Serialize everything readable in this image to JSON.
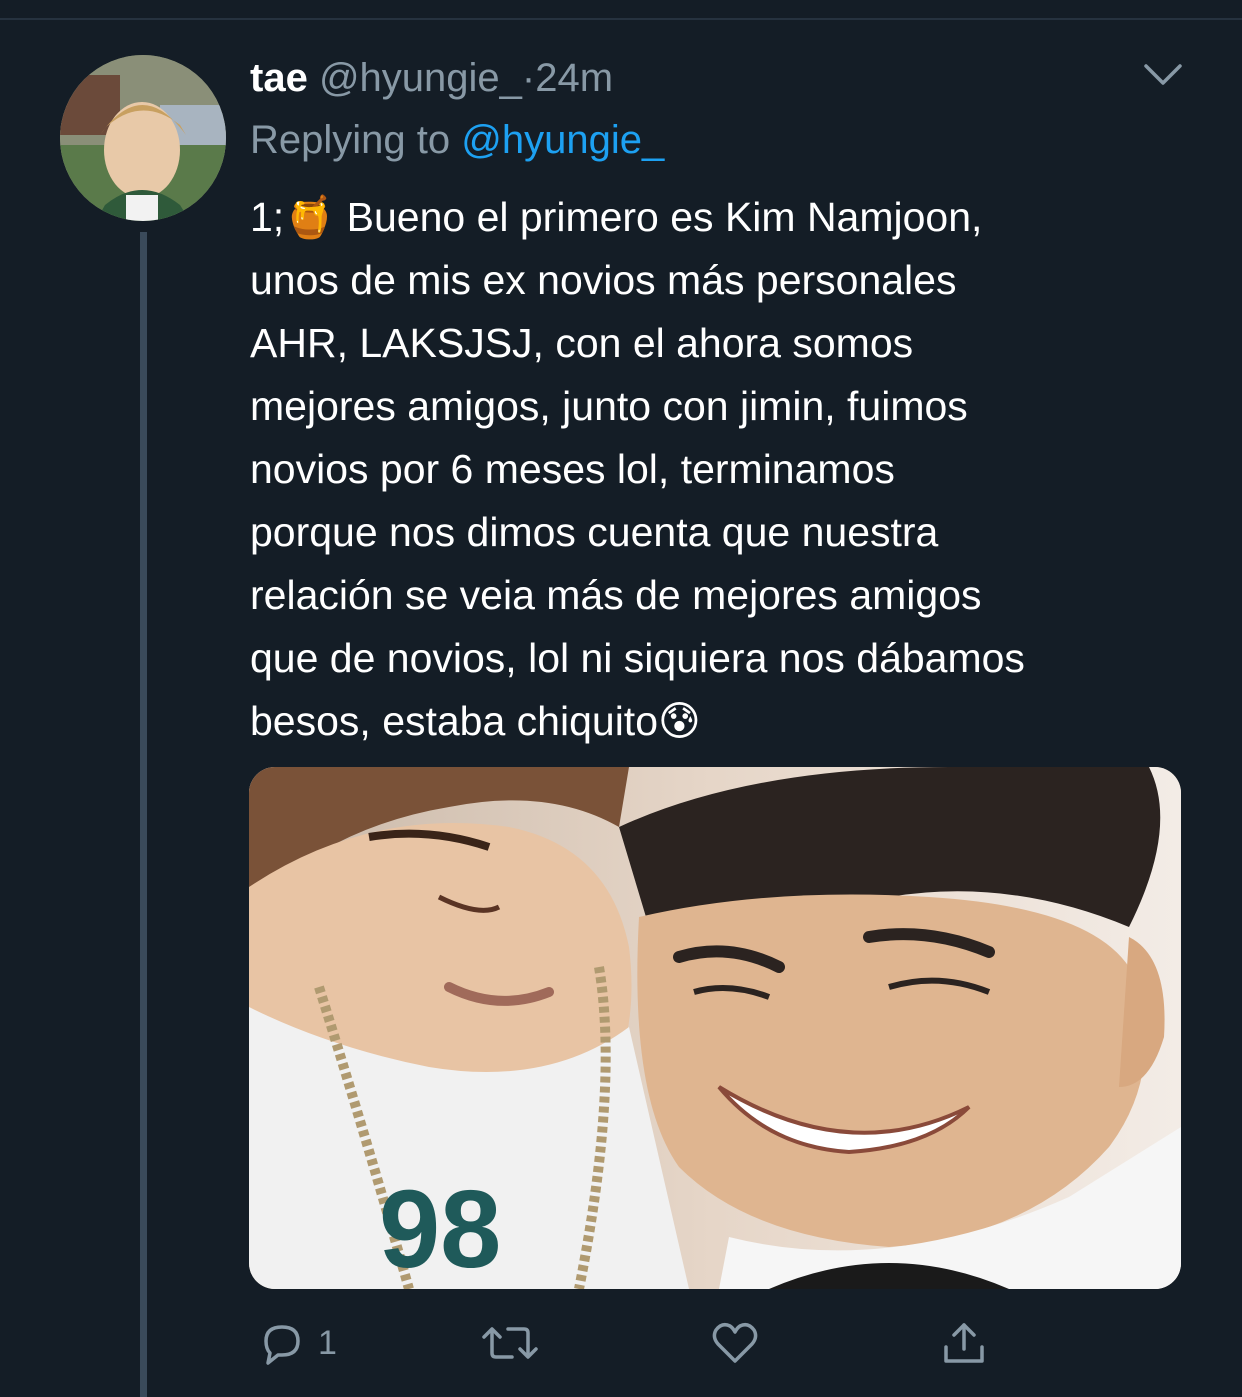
{
  "tweet": {
    "author_name": "tae",
    "author_handle": "@hyungie_",
    "separator": "·",
    "time": "24m",
    "replying_prefix": "Replying to ",
    "replying_to": "@hyungie_",
    "text": "1;🍯 Bueno el primero es Kim Namjoon,\nunos de mis ex novios más personales\nAHR, LAKSJSJ, con el ahora somos\nmejores amigos, junto con jimin, fuimos\nnovios por 6 meses lol, terminamos\nporque nos dimos cuenta que nuestra\nrelación se veia más de mejores amigos\nque de novios, lol ni siquiera nos dábamos\nbesos, estaba chiquito😰"
  },
  "actions": {
    "reply_count": "1",
    "retweet_count": "",
    "like_count": ""
  },
  "icons": {
    "menu": "chevron-down-icon",
    "reply": "reply-icon",
    "retweet": "retweet-icon",
    "like": "heart-icon",
    "share": "share-icon"
  },
  "colors": {
    "background": "#141d26",
    "secondary_text": "#8899a6",
    "link": "#1da1f2",
    "primary_text": "#ffffff"
  }
}
